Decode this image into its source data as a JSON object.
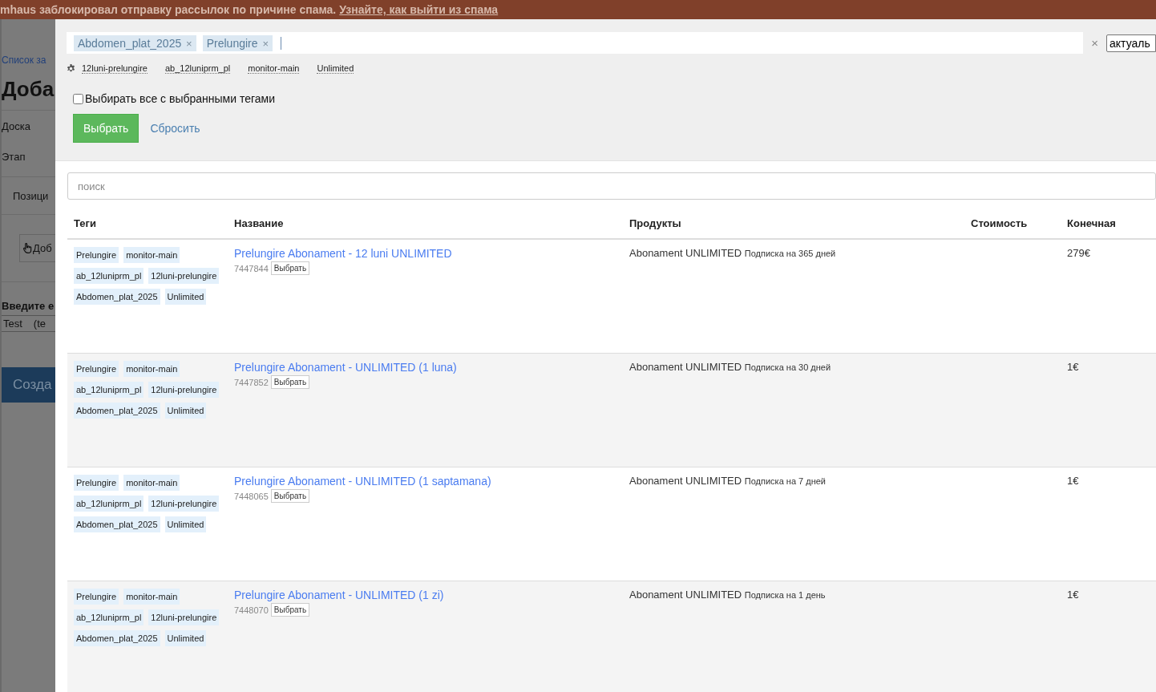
{
  "banner": {
    "text": "mhaus заблокировал отправку рассылок по причине спама.",
    "link": "Узнайте, как выйти из спама"
  },
  "background_page": {
    "breadcrumb": "Список за",
    "heading": "Доба",
    "fields": [
      "Доска",
      "Этап",
      "Позици"
    ],
    "add_button": "Доб",
    "prompt": "Введите е",
    "input_value": "Test",
    "input_extra": "(te",
    "create_button": "Созда"
  },
  "modal": {
    "selected_tags": [
      {
        "label": "Abdomen_plat_2025",
        "remove": "×"
      },
      {
        "label": "Prelungire",
        "remove": "×"
      }
    ],
    "clear": "×",
    "status_select": "актуаль",
    "suggested_tags": [
      "12luni-prelungire",
      "ab_12luniprm_pl",
      "monitor-main",
      "Unlimited"
    ],
    "select_all": {
      "label": "Выбирать все с выбранными тегами",
      "checked": false
    },
    "apply_button": "Выбрать",
    "reset_link": "Сбросить",
    "search": {
      "placeholder": "поиск"
    },
    "table": {
      "columns": [
        "Теги",
        "Название",
        "Продукты",
        "Стоимость",
        "Конечная"
      ],
      "rows": [
        {
          "tags": [
            "Prelungire",
            "monitor-main",
            "ab_12luniprm_pl",
            "12luni-prelungire",
            "Abdomen_plat_2025",
            "Unlimited"
          ],
          "name": "Prelungire Abonament - 12 luni UNLIMITED",
          "id": "7447844",
          "select_button": "Выбрать",
          "product": "Abonament UNLIMITED",
          "product_note": "Подписка на 365 дней",
          "price": "279€"
        },
        {
          "tags": [
            "Prelungire",
            "monitor-main",
            "ab_12luniprm_pl",
            "12luni-prelungire",
            "Abdomen_plat_2025",
            "Unlimited"
          ],
          "name": "Prelungire Abonament - UNLIMITED (1 luna)",
          "id": "7447852",
          "select_button": "Выбрать",
          "product": "Abonament UNLIMITED",
          "product_note": "Подписка на 30 дней",
          "price": "1€"
        },
        {
          "tags": [
            "Prelungire",
            "monitor-main",
            "ab_12luniprm_pl",
            "12luni-prelungire",
            "Abdomen_plat_2025",
            "Unlimited"
          ],
          "name": "Prelungire Abonament - UNLIMITED (1 saptamana)",
          "id": "7448065",
          "select_button": "Выбрать",
          "product": "Abonament UNLIMITED",
          "product_note": "Подписка на 7 дней",
          "price": "1€"
        },
        {
          "tags": [
            "Prelungire",
            "monitor-main",
            "ab_12luniprm_pl",
            "12luni-prelungire",
            "Abdomen_plat_2025",
            "Unlimited"
          ],
          "name": "Prelungire Abonament - UNLIMITED (1 zi)",
          "id": "7448070",
          "select_button": "Выбрать",
          "product": "Abonament UNLIMITED",
          "product_note": "Подписка на 1 день",
          "price": "1€"
        }
      ]
    }
  }
}
